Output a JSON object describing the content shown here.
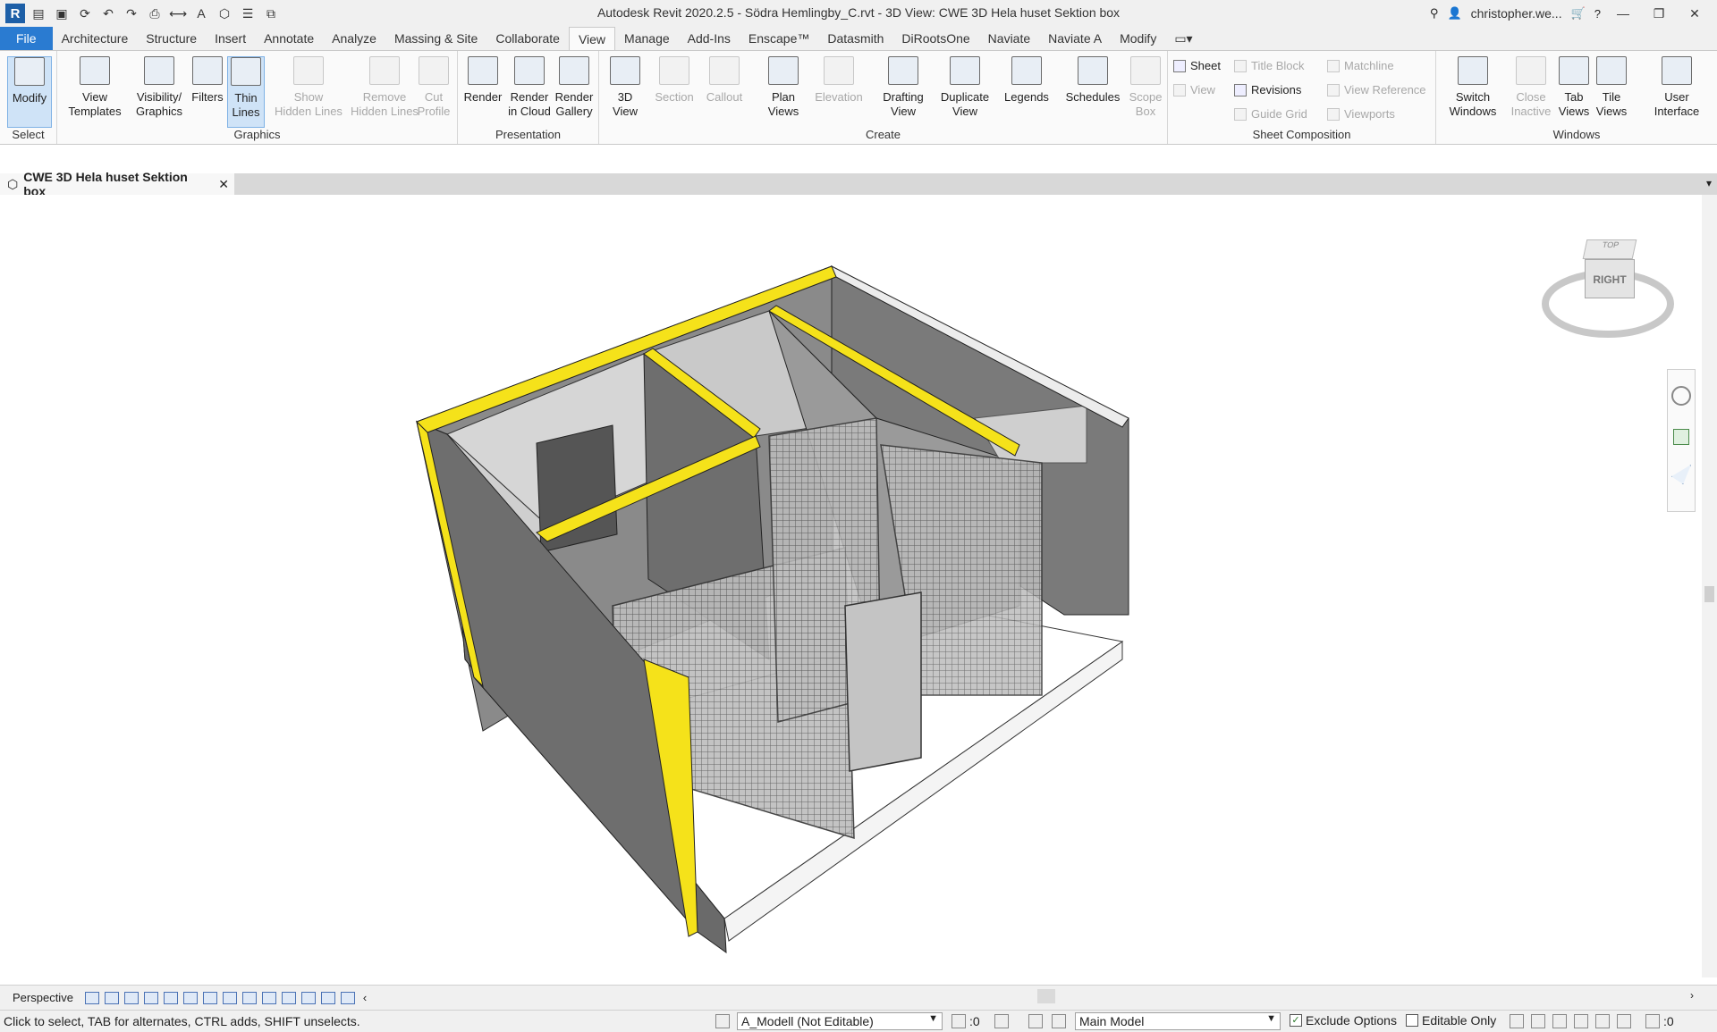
{
  "window": {
    "title": "Autodesk Revit 2020.2.5 - Södra Hemlingby_C.rvt - 3D View: CWE 3D Hela huset Sektion box",
    "user": "christopher.we...",
    "help": "?",
    "minimize": "—",
    "restore": "❐",
    "close": "✕"
  },
  "tabs": [
    "File",
    "Architecture",
    "Structure",
    "Insert",
    "Annotate",
    "Analyze",
    "Massing & Site",
    "Collaborate",
    "View",
    "Manage",
    "Add-Ins",
    "Enscape™",
    "Datasmith",
    "DiRootsOne",
    "Naviate",
    "Naviate A",
    "Modify"
  ],
  "ribbon": {
    "panels": {
      "select": "Select",
      "graphics": "Graphics",
      "presentation": "Presentation",
      "create": "Create",
      "sheet_composition": "Sheet Composition",
      "windows": "Windows"
    },
    "buttons": {
      "modify": "Modify",
      "view_templates": "View\nTemplates",
      "visibility_graphics": "Visibility/\nGraphics",
      "filters": "Filters",
      "thin_lines": "Thin\nLines",
      "show_hidden_lines": "Show\nHidden Lines",
      "remove_hidden_lines": "Remove\nHidden Lines",
      "cut_profile": "Cut\nProfile",
      "render": "Render",
      "render_in_cloud": "Render\nin Cloud",
      "render_gallery": "Render\nGallery",
      "view_3d": "3D\nView",
      "section": "Section",
      "callout": "Callout",
      "plan_views": "Plan\nViews",
      "elevation": "Elevation",
      "drafting_view": "Drafting\nView",
      "duplicate_view": "Duplicate\nView",
      "legends": "Legends",
      "schedules": "Schedules",
      "scope_box": "Scope\nBox",
      "switch_windows": "Switch\nWindows",
      "close_inactive": "Close\nInactive",
      "tab_views": "Tab\nViews",
      "tile_views": "Tile\nViews",
      "user_interface": "User\nInterface"
    },
    "sheet_items": {
      "sheet": "Sheet",
      "title_block": "Title Block",
      "matchline": "Matchline",
      "view": "View",
      "revisions": "Revisions",
      "view_reference": "View Reference",
      "guide_grid": "Guide Grid",
      "viewports": "Viewports"
    }
  },
  "document_tab": {
    "label": "CWE 3D Hela huset Sektion box",
    "close": "✕"
  },
  "viewcube": {
    "face": "RIGHT",
    "top": "TOP"
  },
  "view_control_bar": {
    "scale": "Perspective"
  },
  "status": {
    "hint": "Click to select, TAB for alternates, CTRL adds, SHIFT unselects.",
    "workset": "A_Modell (Not Editable)",
    "sync_count": ":0",
    "design_option": "Main Model",
    "exclude_options": "Exclude Options",
    "editable_only": "Editable Only",
    "filter_count": ":0"
  },
  "colors": {
    "accent_blue": "#2a7bd1",
    "wall_dark": "#6b6b6b",
    "wall_light": "#d4d4d4",
    "cut_yellow": "#f5e21a"
  }
}
